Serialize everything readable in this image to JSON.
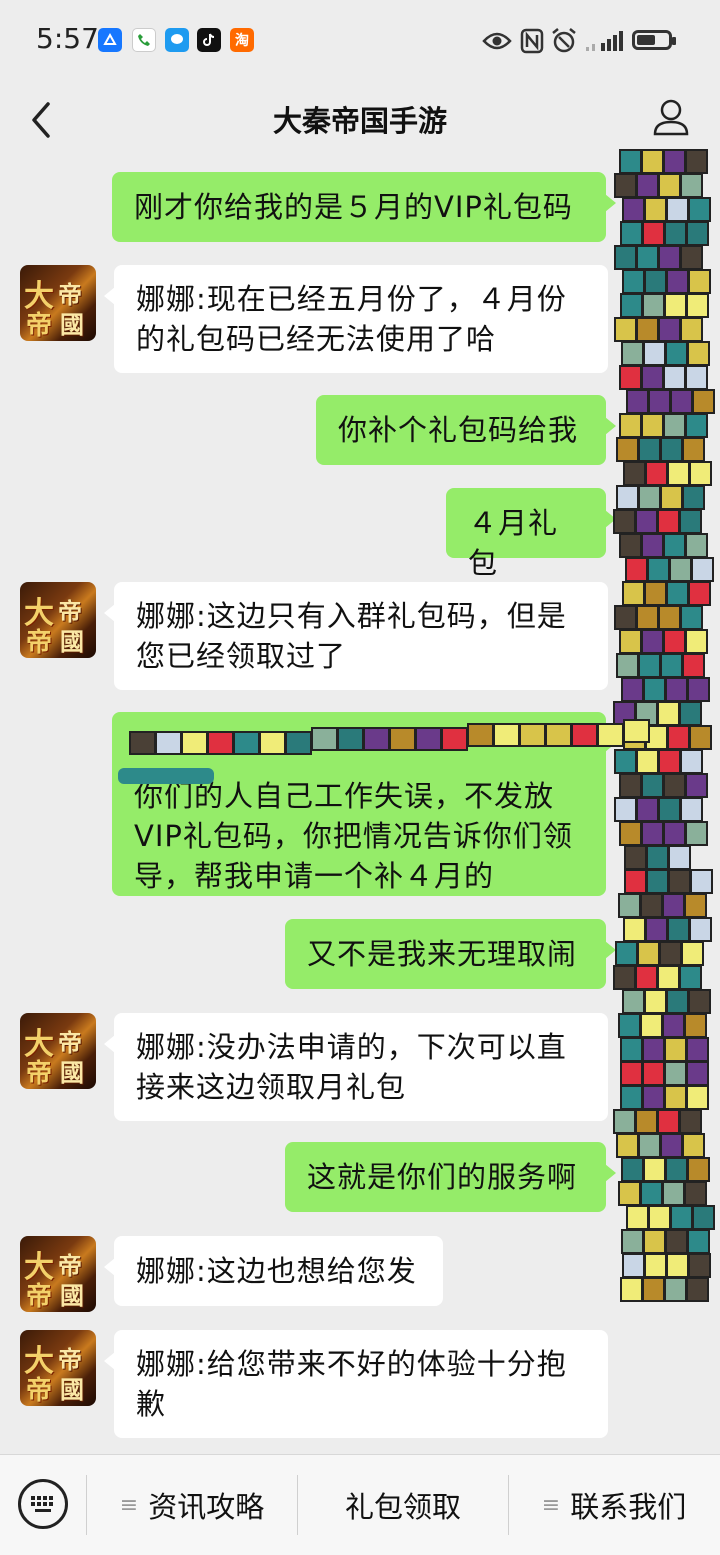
{
  "status_bar": {
    "time": "5:57",
    "notification_icons": [
      "alipay-icon",
      "phone-icon",
      "message-icon",
      "tiktok-icon",
      "taobao-icon"
    ],
    "taobao_glyph": "淘",
    "indicators": [
      "eye-icon",
      "nfc-icon",
      "alarm-icon",
      "signal-icon",
      "battery-icon"
    ]
  },
  "nav": {
    "title": "大秦帝国手游"
  },
  "avatar": {
    "line1_a": "大",
    "line1_b": "帝",
    "line2_a": "帝",
    "line2_b": "國"
  },
  "messages": [
    {
      "dir": "out",
      "text": "刚才你给我的是５月的VIP礼包码"
    },
    {
      "dir": "in",
      "text": "娜娜:现在已经五月份了，４月份的礼包码已经无法使用了哈"
    },
    {
      "dir": "out",
      "text": "你补个礼包码给我"
    },
    {
      "dir": "out",
      "text": "４月礼包"
    },
    {
      "dir": "in",
      "text": "娜娜:这边只有入群礼包码，但是您已经领取过了"
    },
    {
      "dir": "out",
      "text": "你们的人自己工作失误，不发放VIP礼包码，你把情况告诉你们领导，帮我申请一个补４月的",
      "partially_obscured": true
    },
    {
      "dir": "out",
      "text": "又不是我来无理取闹"
    },
    {
      "dir": "in",
      "text": "娜娜:没办法申请的，下次可以直接来这边领取月礼包"
    },
    {
      "dir": "out",
      "text": "这就是你们的服务啊"
    },
    {
      "dir": "in",
      "text": "娜娜:这边也想给您发"
    },
    {
      "dir": "in",
      "text": "娜娜:给您带来不好的体验十分抱歉"
    }
  ],
  "bottom_menu": {
    "items": [
      "资讯攻略",
      "礼包领取",
      "联系我们"
    ],
    "keyboard_icon": "keyboard-icon"
  },
  "colors": {
    "outgoing_bubble": "#95ec69",
    "incoming_bubble": "#ffffff",
    "background": "#ededed"
  }
}
